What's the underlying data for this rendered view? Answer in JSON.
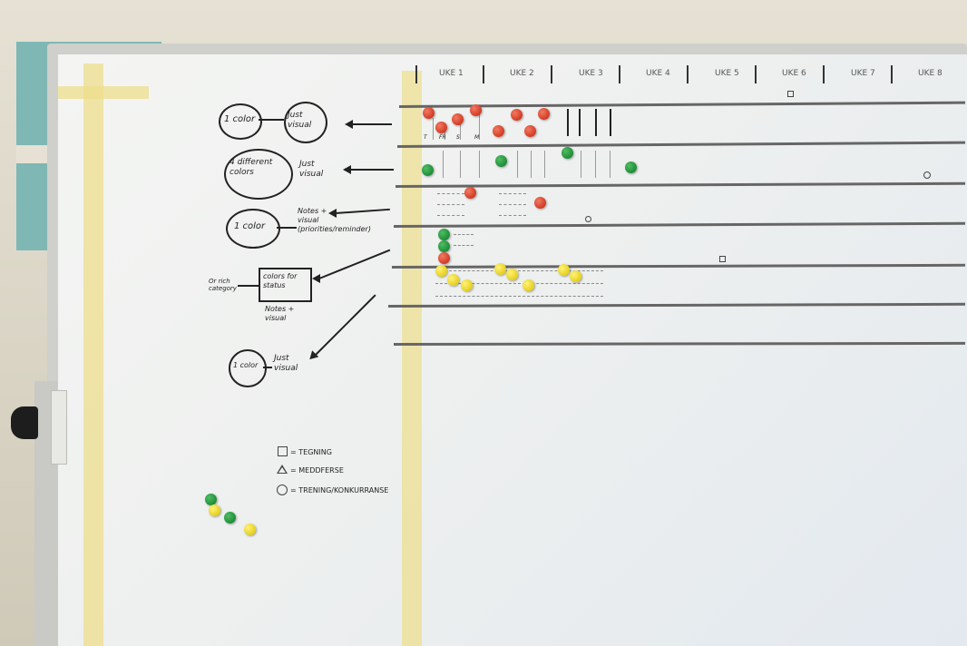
{
  "scene": {
    "description_colors": {
      "red": "#d23a23",
      "green": "#1f8c37",
      "yellow": "#e6cf1c"
    }
  },
  "header": {
    "weeks": [
      "UKE 1",
      "UKE 2",
      "UKE 3",
      "UKE 4",
      "UKE 5",
      "UKE 6",
      "UKE 7",
      "UKE 8"
    ]
  },
  "annotations": {
    "row1_left": "1 color",
    "row1_right": "Just visual",
    "row2_left": "4 different colors",
    "row2_right": "Just visual",
    "row3_left": "1 color",
    "row3_right": "Notes + visual (priorities/reminder)",
    "row4_box": "colors for status",
    "row4_side": "Or rich category",
    "row4_under": "Notes + visual",
    "row5_left": "1 color",
    "row5_right": "Just visual",
    "row1_sublabels": [
      "T",
      "FR",
      "S",
      "M"
    ]
  },
  "legend": {
    "square": "= TEGNING",
    "triangle": "= MEDDFERSE",
    "circle": "= TRENING/KONKURRANSE"
  }
}
